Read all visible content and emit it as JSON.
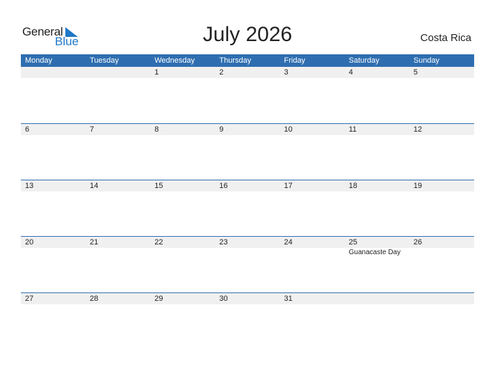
{
  "logo": {
    "general": "General",
    "blue": "Blue"
  },
  "title": "July 2026",
  "country": "Costa Rica",
  "weekdays": [
    "Monday",
    "Tuesday",
    "Wednesday",
    "Thursday",
    "Friday",
    "Saturday",
    "Sunday"
  ],
  "weeks": [
    {
      "days": [
        "",
        "",
        "1",
        "2",
        "3",
        "4",
        "5"
      ],
      "events": [
        "",
        "",
        "",
        "",
        "",
        "",
        ""
      ]
    },
    {
      "days": [
        "6",
        "7",
        "8",
        "9",
        "10",
        "11",
        "12"
      ],
      "events": [
        "",
        "",
        "",
        "",
        "",
        "",
        ""
      ]
    },
    {
      "days": [
        "13",
        "14",
        "15",
        "16",
        "17",
        "18",
        "19"
      ],
      "events": [
        "",
        "",
        "",
        "",
        "",
        "",
        ""
      ]
    },
    {
      "days": [
        "20",
        "21",
        "22",
        "23",
        "24",
        "25",
        "26"
      ],
      "events": [
        "",
        "",
        "",
        "",
        "",
        "Guanacaste Day",
        ""
      ]
    },
    {
      "days": [
        "27",
        "28",
        "29",
        "30",
        "31",
        "",
        ""
      ],
      "events": [
        "",
        "",
        "",
        "",
        "",
        "",
        ""
      ]
    }
  ],
  "colors": {
    "accent": "#2e6eb0",
    "logo_blue": "#1f78c8",
    "row_bg": "#f0f0f0"
  }
}
